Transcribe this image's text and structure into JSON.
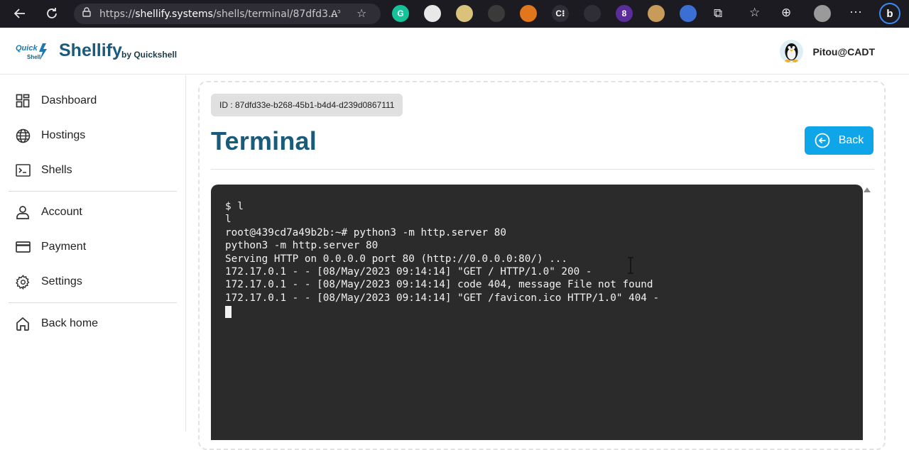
{
  "browser": {
    "url_prefix": "https://",
    "url_host": "shellify.systems",
    "url_path": "/shells/terminal/87dfd3...",
    "extensions": [
      {
        "icon": "grammarly-icon",
        "color": "#15c39a",
        "text": "G"
      },
      {
        "icon": "color-wheel-icon",
        "color": "#e8e8e8",
        "text": ""
      },
      {
        "icon": "palette-icon",
        "color": "#d9c27a",
        "text": ""
      },
      {
        "icon": "hat-icon",
        "color": "#3a3a3a",
        "text": ""
      },
      {
        "icon": "metamask-fox-icon",
        "color": "#e2761b",
        "text": ""
      },
      {
        "icon": "code-icon",
        "color": "#2f2e36",
        "text": "C⁝"
      },
      {
        "icon": "atom-icon",
        "color": "#2f2e36",
        "text": ""
      },
      {
        "icon": "gem-icon",
        "color": "#5b2d9c",
        "text": "8"
      },
      {
        "icon": "cookie-icon",
        "color": "#c89b5b",
        "text": ""
      },
      {
        "icon": "globe-search-icon",
        "color": "#3b6fd4",
        "text": ""
      }
    ]
  },
  "header": {
    "logo_top": "Quick",
    "logo_bottom": "Shell",
    "brand": "Shellify",
    "brand_sub": "by Quickshell",
    "user_name": "Pitou@CADT"
  },
  "sidebar": {
    "items": [
      {
        "label": "Dashboard",
        "icon": "dashboard-grid-icon"
      },
      {
        "label": "Hostings",
        "icon": "globe-icon"
      },
      {
        "label": "Shells",
        "icon": "terminal-icon"
      },
      {
        "label": "Account",
        "icon": "user-icon"
      },
      {
        "label": "Payment",
        "icon": "credit-card-icon"
      },
      {
        "label": "Settings",
        "icon": "gear-icon"
      },
      {
        "label": "Back home",
        "icon": "home-icon"
      }
    ]
  },
  "main": {
    "id_badge": "ID : 87dfd33e-b268-45b1-b4d4-d239d0867111",
    "title": "Terminal",
    "back_label": "Back"
  },
  "terminal": {
    "lines": [
      "$ l",
      "l",
      "root@439cd7a49b2b:~# python3 -m http.server 80",
      "python3 -m http.server 80",
      "Serving HTTP on 0.0.0.0 port 80 (http://0.0.0.0:80/) ...",
      "172.17.0.1 - - [08/May/2023 09:14:14] \"GET / HTTP/1.0\" 200 -",
      "172.17.0.1 - - [08/May/2023 09:14:14] code 404, message File not found",
      "172.17.0.1 - - [08/May/2023 09:14:14] \"GET /favicon.ico HTTP/1.0\" 404 -"
    ]
  },
  "colors": {
    "brand": "#1b5b7a",
    "accent": "#0ea5e9",
    "terminal_bg": "#2b2b2b"
  }
}
